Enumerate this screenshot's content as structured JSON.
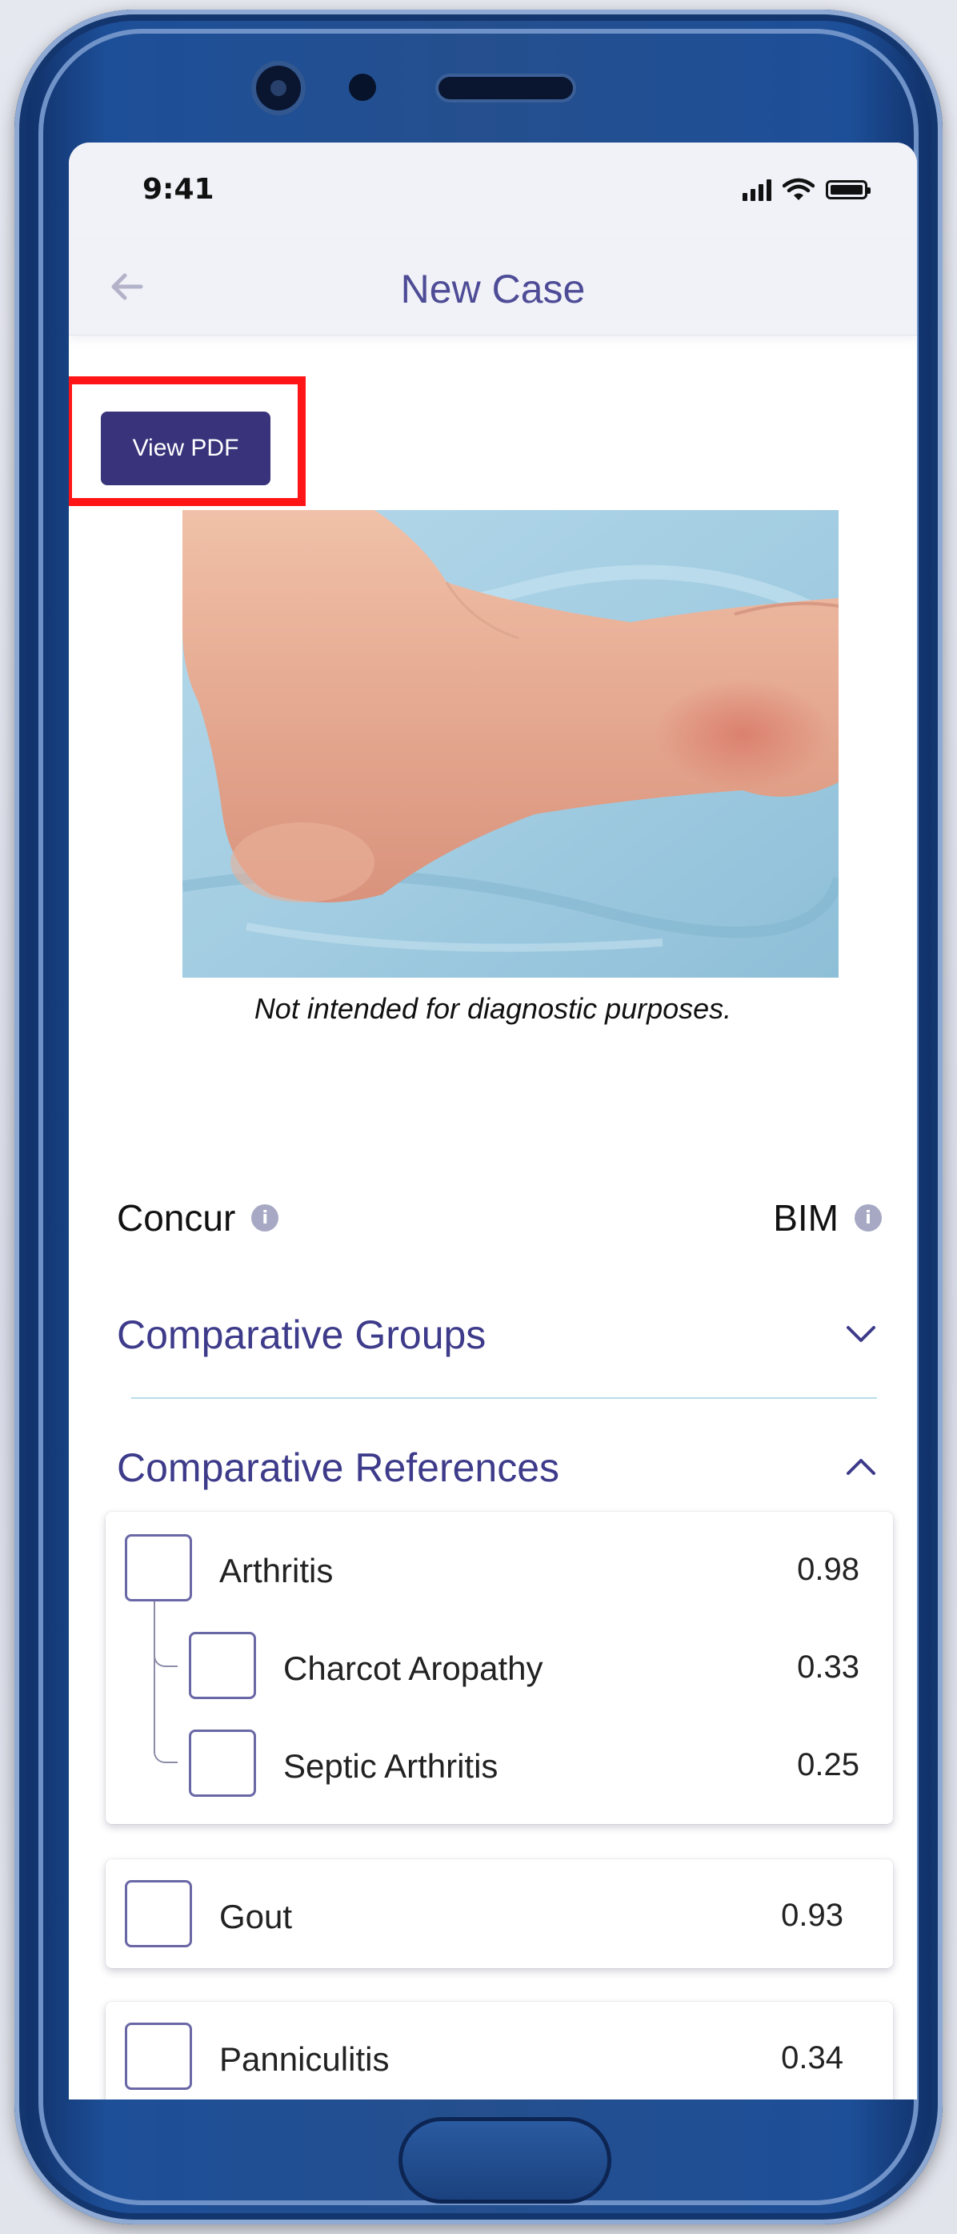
{
  "status_bar": {
    "time": "9:41"
  },
  "nav": {
    "title": "New Case",
    "back_icon": "arrow-left-icon"
  },
  "actions": {
    "view_pdf_label": "View PDF"
  },
  "image": {
    "disclaimer": "Not intended for diagnostic purposes."
  },
  "columns": {
    "left_label": "Concur",
    "right_label": "BIM"
  },
  "sections": {
    "groups_title": "Comparative Groups",
    "references_title": "Comparative References"
  },
  "references": [
    {
      "label": "Arthritis",
      "score": "0.98",
      "children": [
        {
          "label": "Charcot Aropathy",
          "score": "0.33"
        },
        {
          "label": "Septic Arthritis",
          "score": "0.25"
        }
      ]
    },
    {
      "label": "Gout",
      "score": "0.93"
    },
    {
      "label": "Panniculitis",
      "score": "0.34"
    }
  ],
  "colors": {
    "accent": "#3d3b8a",
    "button": "#38337a",
    "highlight": "#ff1515",
    "divider": "#b9dde9"
  }
}
